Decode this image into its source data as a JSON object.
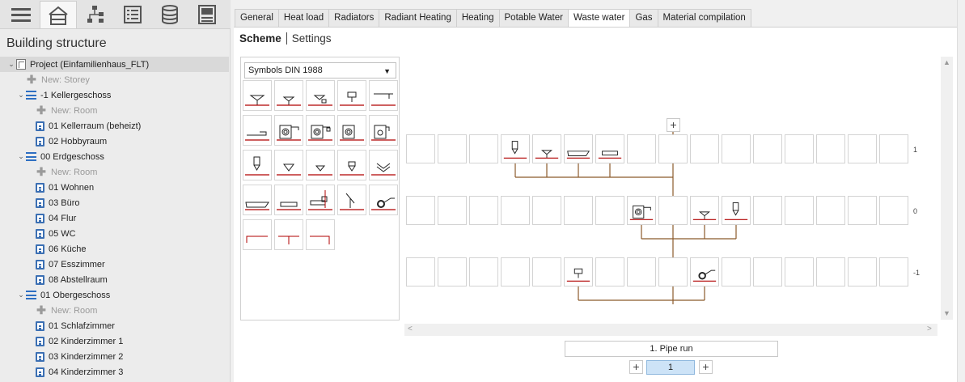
{
  "left_panel": {
    "title": "Building structure",
    "toolbar": [
      "menu-icon",
      "building-icon",
      "network-icon",
      "list-icon",
      "database-icon",
      "panel-icon"
    ],
    "tree": [
      {
        "label": "Project (Einfamilienhaus_FLT)",
        "kind": "project",
        "level": 0,
        "twisty": "open",
        "selected": true
      },
      {
        "label": "New: Storey",
        "kind": "new",
        "level": 1
      },
      {
        "label": "-1 Kellergeschoss",
        "kind": "storey",
        "level": 1,
        "twisty": "open"
      },
      {
        "label": "New: Room",
        "kind": "new",
        "level": 2
      },
      {
        "label": "01 Kellerraum (beheizt)",
        "kind": "room",
        "level": 2
      },
      {
        "label": "02 Hobbyraum",
        "kind": "room",
        "level": 2
      },
      {
        "label": "00 Erdgeschoss",
        "kind": "storey",
        "level": 1,
        "twisty": "open"
      },
      {
        "label": "New: Room",
        "kind": "new",
        "level": 2
      },
      {
        "label": "01 Wohnen",
        "kind": "room",
        "level": 2
      },
      {
        "label": "03 Büro",
        "kind": "room",
        "level": 2
      },
      {
        "label": "04 Flur",
        "kind": "room",
        "level": 2
      },
      {
        "label": "05 WC",
        "kind": "room",
        "level": 2
      },
      {
        "label": "06 Küche",
        "kind": "room",
        "level": 2
      },
      {
        "label": "07 Esszimmer",
        "kind": "room",
        "level": 2
      },
      {
        "label": "08 Abstellraum",
        "kind": "room",
        "level": 2
      },
      {
        "label": "01 Obergeschoss",
        "kind": "storey",
        "level": 1,
        "twisty": "open"
      },
      {
        "label": "New: Room",
        "kind": "new",
        "level": 2
      },
      {
        "label": "01 Schlafzimmer",
        "kind": "room",
        "level": 2
      },
      {
        "label": "02 Kinderzimmer 1",
        "kind": "room",
        "level": 2
      },
      {
        "label": "03 Kinderzimmer 2",
        "kind": "room",
        "level": 2
      },
      {
        "label": "04 Kinderzimmer 3",
        "kind": "room",
        "level": 2
      }
    ]
  },
  "tabs": [
    {
      "label": "General"
    },
    {
      "label": "Heat load"
    },
    {
      "label": "Radiators"
    },
    {
      "label": "Radiant Heating"
    },
    {
      "label": "Heating"
    },
    {
      "label": "Potable Water"
    },
    {
      "label": "Waste water",
      "active": true
    },
    {
      "label": "Gas"
    },
    {
      "label": "Material compilation"
    }
  ],
  "subtabs": {
    "active": "Scheme",
    "other": "Settings"
  },
  "palette": {
    "select_value": "Symbols DIN 1988",
    "symbols": [
      "funnel-icon",
      "small-funnel-icon",
      "funnel-with-trap-icon",
      "wall-outlet-icon",
      "wall-hook-icon",
      "sink-icon",
      "washing-machine-icon",
      "dishwasher-icon",
      "dryer-icon",
      "appliance-icon",
      "tall-fixture-icon",
      "triangle-drain-icon",
      "small-triangle-icon",
      "valve-drain-icon",
      "chevron-drain-icon",
      "bathtub-icon",
      "shower-tray-icon",
      "wall-fixture-icon",
      "pipe-bend-icon",
      "loop-drain-icon",
      "pipe-left-icon",
      "pipe-tee-icon",
      "pipe-right-icon"
    ]
  },
  "scheme": {
    "levels": [
      {
        "label": "1",
        "row": 0
      },
      {
        "label": "0",
        "row": 1
      },
      {
        "label": "-1",
        "row": 2
      }
    ],
    "placed_symbols": [
      {
        "row": 0,
        "col": 3,
        "icon": "tall-fixture-icon"
      },
      {
        "row": 0,
        "col": 4,
        "icon": "small-funnel-icon"
      },
      {
        "row": 0,
        "col": 5,
        "icon": "bathtub-icon"
      },
      {
        "row": 0,
        "col": 6,
        "icon": "shower-tray-icon"
      },
      {
        "row": 1,
        "col": 7,
        "icon": "washing-machine-icon"
      },
      {
        "row": 1,
        "col": 9,
        "icon": "small-funnel-icon"
      },
      {
        "row": 1,
        "col": 10,
        "icon": "tall-fixture-icon"
      },
      {
        "row": 2,
        "col": 5,
        "icon": "wall-outlet-icon"
      },
      {
        "row": 2,
        "col": 9,
        "icon": "loop-drain-icon"
      }
    ]
  },
  "pipe_run": {
    "value": "1. Pipe run",
    "page": "1"
  },
  "colors": {
    "pipe": "#8b5a2b",
    "symbol_line": "#b00000",
    "accent": "#2e6fc2"
  }
}
